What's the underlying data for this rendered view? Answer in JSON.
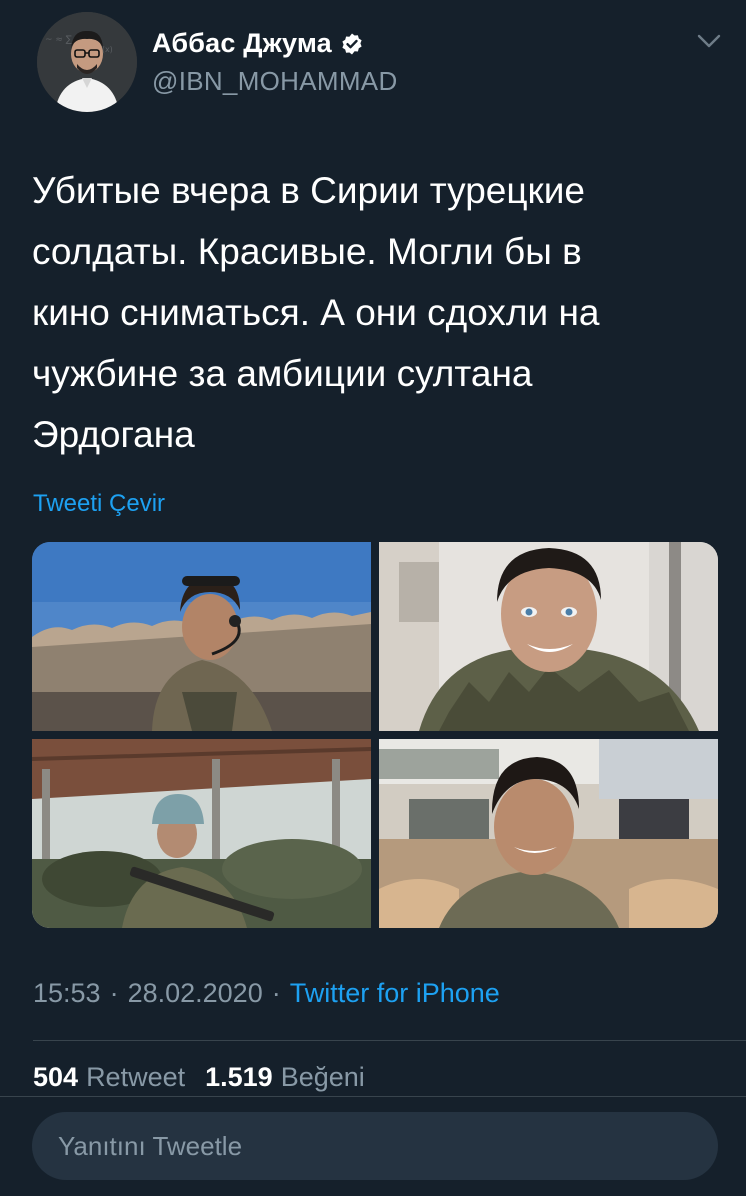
{
  "author": {
    "display_name": "Аббас Джума",
    "handle": "@IBN_MOHAMMAD",
    "verified": true
  },
  "tweet": {
    "text": "Убитые вчера в Сирии турецкие\nсолдаты. Красивые. Могли бы в\nкино сниматься. А они сдохли на\nчужбине за амбиции султана\nЭрдогана",
    "translate_label": "Tweeti Çevir"
  },
  "media": {
    "count": 4
  },
  "meta": {
    "time": "15:53",
    "date": "28.02.2020",
    "separator": "·",
    "source": "Twitter for iPhone"
  },
  "stats": {
    "retweets": "504",
    "retweets_label": "Retweet",
    "likes": "1.519",
    "likes_label": "Beğeni"
  },
  "reply": {
    "placeholder": "Yanıtını Tweetle"
  },
  "colors": {
    "background": "#15202b",
    "accent": "#1da1f2",
    "secondary_text": "#8899a6",
    "divider": "#38444d",
    "input_bg": "#253341"
  },
  "icons": {
    "verified": "verified-badge-icon",
    "more": "chevron-down-icon"
  }
}
